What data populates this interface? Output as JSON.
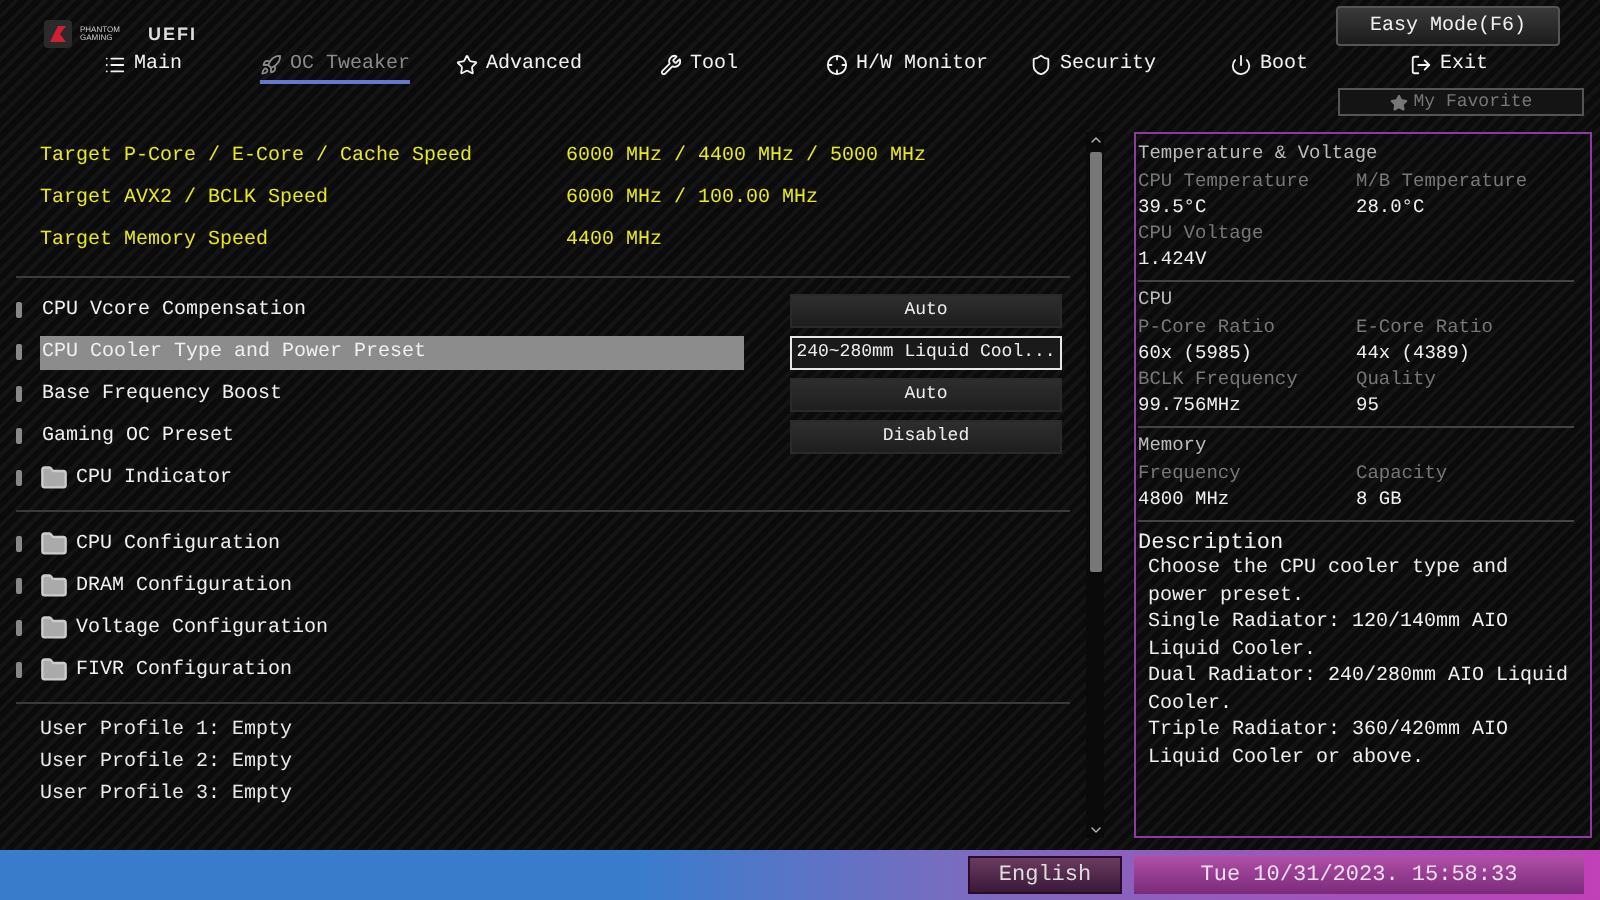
{
  "header": {
    "brand": "PHANTOM GAMING",
    "product": "UEFI",
    "easy_mode": "Easy Mode(F6)",
    "favorite": "My Favorite"
  },
  "tabs": [
    {
      "label": "Main",
      "selected": false
    },
    {
      "label": "OC Tweaker",
      "selected": true
    },
    {
      "label": "Advanced",
      "selected": false
    },
    {
      "label": "Tool",
      "selected": false
    },
    {
      "label": "H/W Monitor",
      "selected": false
    },
    {
      "label": "Security",
      "selected": false
    },
    {
      "label": "Boot",
      "selected": false
    },
    {
      "label": "Exit",
      "selected": false
    }
  ],
  "targets": [
    {
      "label": "Target P-Core / E-Core / Cache Speed",
      "value": "6000 MHz / 4400 MHz / 5000 MHz"
    },
    {
      "label": "Target AVX2 / BCLK Speed",
      "value": "6000 MHz / 100.00 MHz"
    },
    {
      "label": "Target Memory Speed",
      "value": "4400 MHz"
    }
  ],
  "settings": [
    {
      "kind": "option",
      "label": "CPU Vcore Compensation",
      "value": "Auto",
      "selected": false
    },
    {
      "kind": "option",
      "label": "CPU Cooler Type and Power Preset",
      "value": "240~280mm Liquid Cool...",
      "selected": true
    },
    {
      "kind": "option",
      "label": "Base Frequency Boost",
      "value": "Auto",
      "selected": false
    },
    {
      "kind": "option",
      "label": "Gaming OC Preset",
      "value": "Disabled",
      "selected": false
    },
    {
      "kind": "folder",
      "label": "CPU Indicator",
      "selected": false
    }
  ],
  "configurations": [
    {
      "kind": "folder",
      "label": "CPU Configuration",
      "selected": false
    },
    {
      "kind": "folder",
      "label": "DRAM Configuration",
      "selected": false
    },
    {
      "kind": "folder",
      "label": "Voltage Configuration",
      "selected": false
    },
    {
      "kind": "folder",
      "label": "FIVR Configuration",
      "selected": false
    }
  ],
  "profiles": [
    "User Profile 1: Empty",
    "User Profile 2: Empty",
    "User Profile 3: Empty"
  ],
  "monitor": [
    {
      "title": "Temperature & Voltage",
      "fields": [
        {
          "label": "CPU Temperature",
          "value": "39.5°C"
        },
        {
          "label": "M/B Temperature",
          "value": "28.0°C"
        },
        {
          "label": "CPU Voltage",
          "value": "1.424V"
        }
      ]
    },
    {
      "title": "CPU",
      "fields": [
        {
          "label": "P-Core Ratio",
          "value": "60x (5985)"
        },
        {
          "label": "E-Core Ratio",
          "value": "44x (4389)"
        },
        {
          "label": "BCLK Frequency",
          "value": "99.756MHz"
        },
        {
          "label": "Quality",
          "value": "95"
        }
      ]
    },
    {
      "title": "Memory",
      "fields": [
        {
          "label": "Frequency",
          "value": "4800 MHz"
        },
        {
          "label": "Capacity",
          "value": "8 GB"
        }
      ]
    }
  ],
  "description": {
    "title": "Description",
    "paragraphs": [
      "Choose the CPU cooler type and power preset.",
      "Single Radiator: 120/140mm AIO Liquid Cooler.",
      "Dual Radiator: 240/280mm AIO Liquid Cooler.",
      "Triple Radiator: 360/420mm AIO Liquid Cooler or above."
    ]
  },
  "status_bar": {
    "language": "English",
    "datetime": "Tue 10/31/2023. 15:58:33"
  }
}
